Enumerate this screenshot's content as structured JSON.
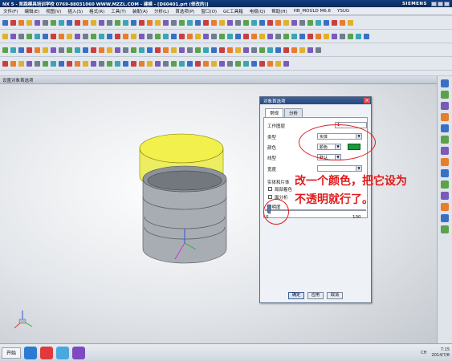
{
  "title": {
    "left": "NX 5 - 凯跑模具培训学校  0769-88031060  WWW.MZZL.COM - 建模 - [D60401.prt (修改的)]",
    "brand": "SIEMENS"
  },
  "menu": [
    "文件(F)",
    "编辑(E)",
    "视图(V)",
    "插入(S)",
    "格式(R)",
    "工具(T)",
    "装配(A)",
    "分析(L)",
    "首选项(P)",
    "窗口(O)",
    "GC工具箱",
    "电极(Q)",
    "帮助(H)",
    "HB_MOULD M6.6",
    "YSUG"
  ],
  "toolbar_colors": [
    "#3a6fc4",
    "#e0b12b",
    "#5aa24b",
    "#c93f3f",
    "#7a5bb8",
    "#3aa5b5",
    "#e87d2c",
    "#6f7d8e"
  ],
  "viewport_title": "设置对象首选项",
  "dialog": {
    "title": "对象首选项",
    "tabs": [
      "常规",
      "分析"
    ],
    "labels": {
      "work_layer": "工作图层",
      "type": "类型",
      "color": "颜色",
      "line_type": "线型",
      "width": "宽度",
      "solid_sheet": "实体和片体",
      "partial_shading": "局部着色",
      "face_analysis": "面分析",
      "transparency": "透明度"
    },
    "values": {
      "work_layer": "1",
      "type": "实体",
      "color_label": "颜色",
      "color_swatch": "#1b9a3a",
      "line_type": "默认",
      "transparency_value": "0",
      "slider_min": "0",
      "slider_max": "100",
      "transparency": 0
    },
    "buttons": [
      "确定",
      "应用",
      "取消"
    ]
  },
  "annotation": {
    "line1": "改一个颜色，把它设为",
    "line2": "不透明就行了。"
  },
  "taskbar": {
    "start": "开始",
    "tray_text": "CH",
    "time": "7:15",
    "date": "2014/7/8"
  }
}
